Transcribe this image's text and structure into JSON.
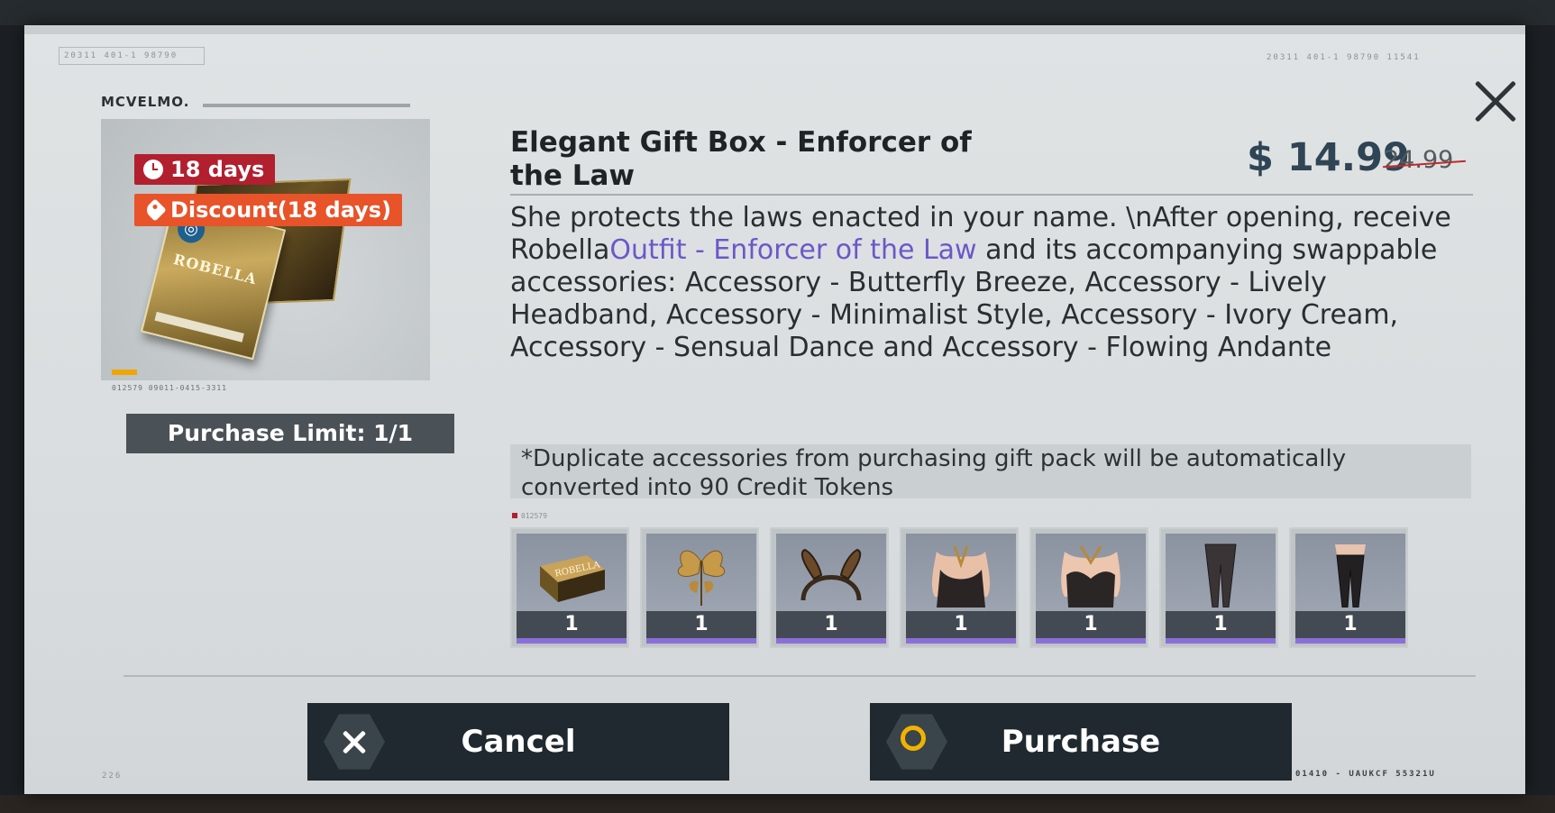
{
  "panel": {
    "close_label": "✕",
    "brand": "MCVELMO.",
    "header_code_left": "20311   401-1   98790",
    "header_code_right": "20311   401-1   98790   11541",
    "footer_code_left": "226",
    "footer_code_right": "01410 - UAUKCF  55321U"
  },
  "gift": {
    "box_label": "ROBELLA",
    "art_code": "012579  09011-0415-3311",
    "timer": "18 days",
    "discount": "Discount(18 days)",
    "purchase_limit": "Purchase Limit: 1/1"
  },
  "product": {
    "title": "Elegant Gift Box - Enforcer of the Law",
    "price": "$ 14.99",
    "original_price": "24.99",
    "desc_before": "She protects the laws enacted in your name. \\nAfter opening, receive Robella",
    "desc_highlight": "Outfit - Enforcer of the Law",
    "desc_after": " and its accompanying swappable accessories: Accessory - Butterfly Breeze, Accessory - Lively Headband, Accessory - Minimalist Style, Accessory - Ivory Cream, Accessory - Sensual Dance and Accessory - Flowing Andante",
    "note": "*Duplicate accessories from purchasing gift pack will be automatically converted into 90 Credit Tokens",
    "items_code": "012579"
  },
  "items": [
    {
      "qty": "1",
      "icon": "gift-box-icon"
    },
    {
      "qty": "1",
      "icon": "butterfly-accessory-icon"
    },
    {
      "qty": "1",
      "icon": "headband-icon"
    },
    {
      "qty": "1",
      "icon": "top-minimalist-icon"
    },
    {
      "qty": "1",
      "icon": "top-ivory-icon"
    },
    {
      "qty": "1",
      "icon": "tights-icon"
    },
    {
      "qty": "1",
      "icon": "stockings-icon"
    }
  ],
  "buttons": {
    "cancel": "Cancel",
    "purchase": "Purchase"
  },
  "colors": {
    "highlight": "#6a58c8",
    "timer_tag": "#b21f2f",
    "discount_tag": "#e8532a",
    "purchase_icon": "#f2b200",
    "rarity": "#8b6fd9"
  }
}
